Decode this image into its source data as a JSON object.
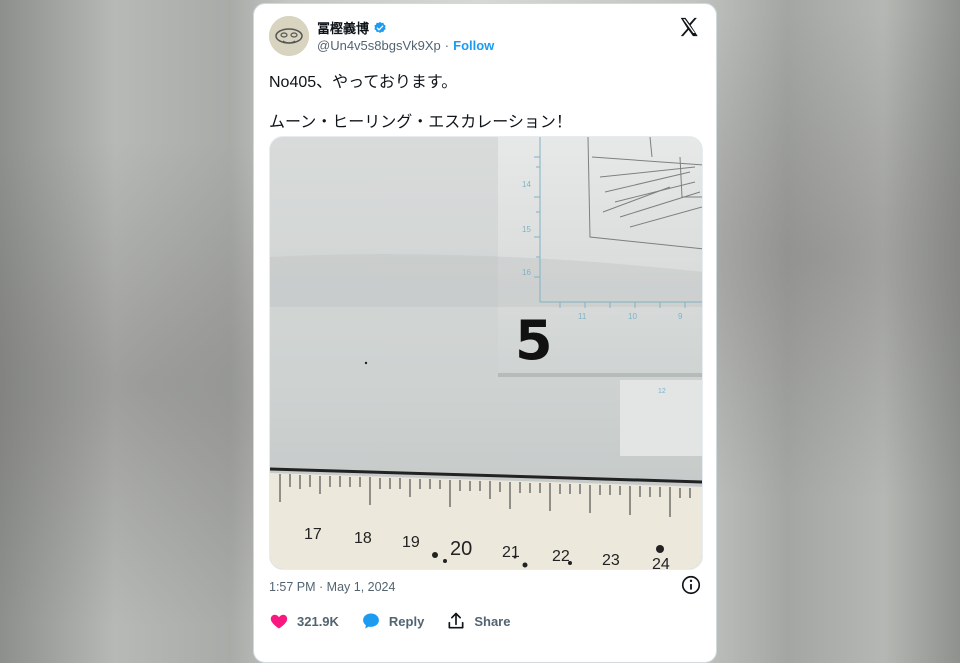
{
  "tweet": {
    "author_name": "冨樫義博",
    "handle": "@Un4v5s8bgsVk9Xp",
    "separator": "·",
    "follow_label": "Follow",
    "text_line1": "No405、やっております。",
    "text_line2": "ムーン・ヒーリング・エスカレーション！",
    "timestamp": "1:57 PM · May 1, 2024"
  },
  "photo": {
    "handwritten_mark": "5",
    "ruler_numbers": [
      "17",
      "18",
      "19",
      "20",
      "21",
      "22",
      "23",
      "24"
    ],
    "grid_numbers": [
      "14",
      "15",
      "16",
      "11",
      "10",
      "9",
      "12"
    ]
  },
  "actions": {
    "like_count": "321.9K",
    "reply_label": "Reply",
    "share_label": "Share"
  },
  "colors": {
    "accent": "#1d9bf0",
    "like": "#f91880",
    "text": "#0f1419",
    "muted": "#536471"
  },
  "icons": [
    "verified-badge-icon",
    "x-logo-icon",
    "info-icon",
    "heart-icon",
    "reply-bubble-icon",
    "share-icon"
  ]
}
